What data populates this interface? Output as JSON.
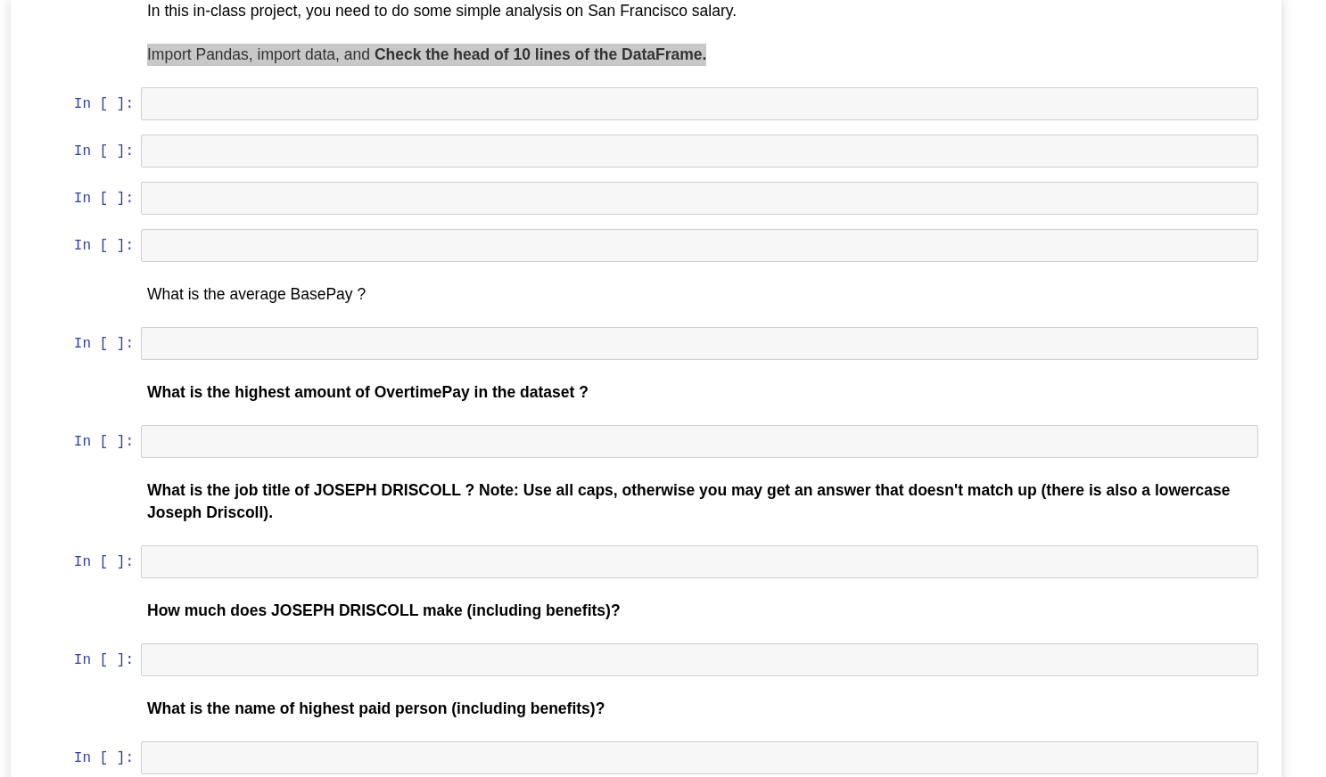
{
  "notebook": {
    "cells": [
      {
        "kind": "markdown",
        "text": "In this in-class project, you need to do some simple analysis on San Francisco salary.",
        "bold": false,
        "highlighted": false
      },
      {
        "kind": "markdown",
        "text": "Import Pandas, import data, and **Check the head of 10 lines of the DataFrame.**",
        "bold": false,
        "highlighted": true
      },
      {
        "kind": "code",
        "prompt": "In [ ]:"
      },
      {
        "kind": "code",
        "prompt": "In [ ]:"
      },
      {
        "kind": "code",
        "prompt": "In [ ]:"
      },
      {
        "kind": "code",
        "prompt": "In [ ]:"
      },
      {
        "kind": "markdown",
        "text": "What is the average BasePay ?",
        "bold": false,
        "highlighted": false
      },
      {
        "kind": "code",
        "prompt": "In [ ]:"
      },
      {
        "kind": "markdown",
        "text": "What is the highest amount of OvertimePay in the dataset ?",
        "bold": true,
        "highlighted": false
      },
      {
        "kind": "code",
        "prompt": "In [ ]:"
      },
      {
        "kind": "markdown",
        "text": "What is the job title of JOSEPH DRISCOLL ? Note: Use all caps, otherwise you may get an answer that doesn't match up (there is also a lowercase Joseph Driscoll).",
        "bold": true,
        "highlighted": false
      },
      {
        "kind": "code",
        "prompt": "In [ ]:"
      },
      {
        "kind": "markdown",
        "text": "How much does JOSEPH DRISCOLL make (including benefits)?",
        "bold": true,
        "highlighted": false
      },
      {
        "kind": "code",
        "prompt": "In [ ]:"
      },
      {
        "kind": "markdown",
        "text": "What is the name of highest paid person (including benefits)?",
        "bold": true,
        "highlighted": false
      },
      {
        "kind": "code",
        "prompt": "In [ ]:"
      }
    ]
  }
}
